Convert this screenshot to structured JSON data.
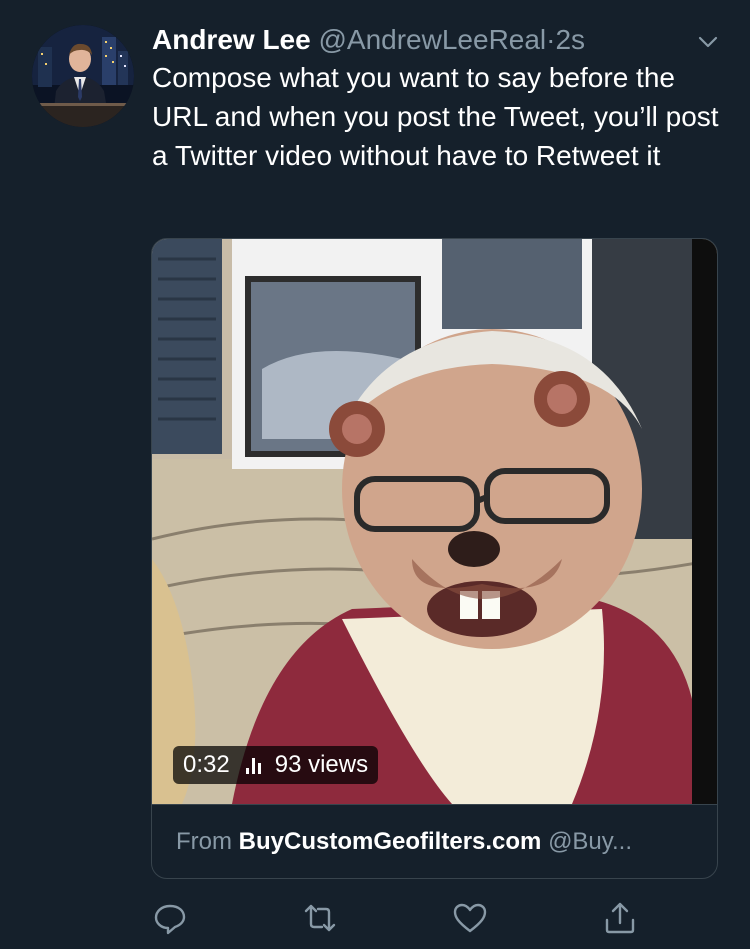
{
  "tweet": {
    "author_name": "Andrew Lee",
    "author_handle": "@AndrewLeeReal",
    "separator": "·",
    "timestamp": "2s",
    "text": "Compose what you want to say before the URL and when you post the Tweet, you’ll post a Twitter video without have to Retweet it"
  },
  "video": {
    "duration": "0:32",
    "views": "93 views",
    "source_prefix": "From",
    "source_domain": "BuyCustomGeofilters.com",
    "source_handle": "@Buy..."
  },
  "actions": {
    "icons": [
      "reply-icon",
      "retweet-icon",
      "like-icon",
      "share-icon"
    ]
  },
  "colors": {
    "background": "#15202b",
    "secondary_text": "#8899a6",
    "border": "#38444d",
    "primary_text": "#ffffff"
  }
}
